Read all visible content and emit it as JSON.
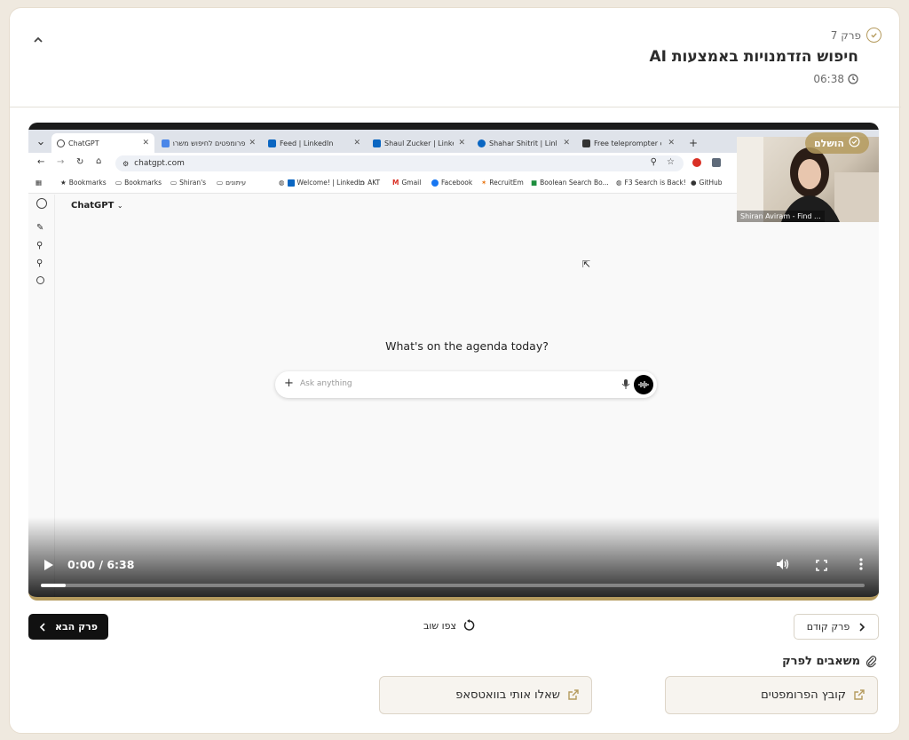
{
  "header": {
    "chapter_label": "פרק 7",
    "title": "חיפוש הזדמנויות באמצעות AI",
    "duration": "06:38"
  },
  "video": {
    "completed_badge": "הושלם",
    "current_time": "0:00 / 6:38",
    "progress": 0.03,
    "camera_name": "Shiran Aviram - Find ...",
    "browser": {
      "tabs": [
        "ChatGPT",
        "פרומפטים לחיפוש משרה",
        "Feed | LinkedIn",
        "Shaul Zucker | LinkedIn",
        "Shahar Shitrit | LinkedIn",
        "Free teleprompter onl"
      ],
      "url": "chatgpt.com",
      "bookmarks": [
        "Bookmarks",
        "Bookmarks",
        "Shiran's",
        "עיתונים",
        "Welcome! | LinkedIn",
        "AKT",
        "Gmail",
        "Facebook",
        "RecruitEm",
        "Boolean Search Bo...",
        "F3 Search is Back!",
        "GitHub"
      ],
      "app_label": "ChatGPT",
      "agenda": "What's on the agenda today?",
      "ask_placeholder": "Ask anything"
    }
  },
  "nav": {
    "next_label": "פרק הבא",
    "rewatch_label": "צפו שוב",
    "prev_label": "פרק קודם"
  },
  "resources": {
    "title": "משאבים לפרק",
    "items": [
      {
        "label": "קובץ הפרומפטים"
      },
      {
        "label": "שאלו אותי בוואטסאפ"
      }
    ]
  },
  "colors": {
    "accent": "#b59b5e",
    "background": "#efe9df"
  }
}
